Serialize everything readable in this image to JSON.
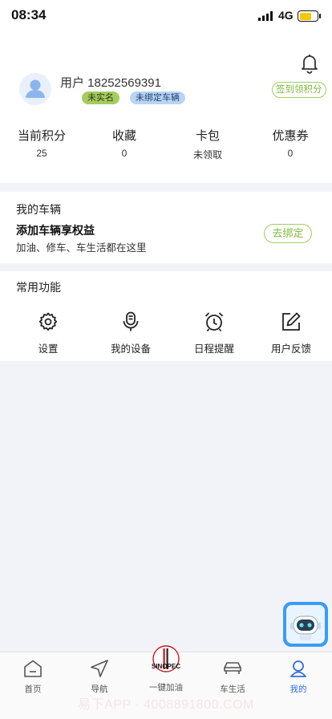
{
  "status": {
    "time": "08:34",
    "network": "4G"
  },
  "profile": {
    "user_name": "用户 18252569391",
    "tags": [
      "未实名",
      "未绑定车辆"
    ],
    "sign_in_label": "签到领积分"
  },
  "stats": [
    {
      "label": "当前积分",
      "value": "25"
    },
    {
      "label": "收藏",
      "value": "0"
    },
    {
      "label": "卡包",
      "value": "未领取"
    },
    {
      "label": "优惠券",
      "value": "0"
    }
  ],
  "vehicle": {
    "section_title": "我的车辆",
    "title": "添加车辆享权益",
    "desc": "加油、修车、车生活都在这里",
    "bind_label": "去绑定"
  },
  "features": {
    "section_title": "常用功能",
    "items": [
      {
        "label": "设置",
        "icon": "gear-icon"
      },
      {
        "label": "我的设备",
        "icon": "microphone-icon"
      },
      {
        "label": "日程提醒",
        "icon": "alarm-clock-icon"
      },
      {
        "label": "用户反馈",
        "icon": "edit-icon"
      }
    ]
  },
  "tabbar": {
    "items": [
      {
        "label": "首页",
        "icon": "home-icon"
      },
      {
        "label": "导航",
        "icon": "navigation-icon"
      },
      {
        "label": "一键加油",
        "icon": "sinopec-logo",
        "logo_text": "SINOPEC"
      },
      {
        "label": "车生活",
        "icon": "car-icon"
      },
      {
        "label": "我的",
        "icon": "user-icon"
      }
    ],
    "active_index": 4,
    "active_color": "#2f6fde"
  },
  "watermark": "易下APP · 4008891800.COM",
  "colors": {
    "accent_green": "#7fb93c",
    "tag_green": "#a6cc60",
    "tag_blue": "#b9d4f4",
    "battery": "#f7c800"
  }
}
